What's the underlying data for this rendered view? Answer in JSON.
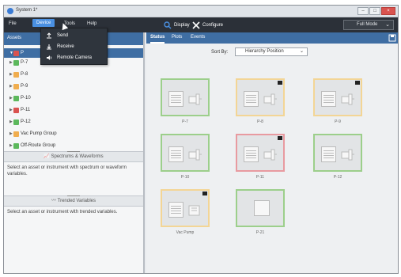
{
  "window": {
    "title": "System 1*"
  },
  "titlebar": {
    "buttons": [
      "minimize-icon",
      "maximize-icon",
      "close-icon"
    ]
  },
  "menubar": {
    "items": [
      "File",
      "Device",
      "Tools",
      "Help"
    ],
    "display_label": "Display",
    "configure_label": "Configure",
    "mode_label": "Full Mode"
  },
  "device_menu": {
    "items": [
      {
        "label": "Send",
        "icon": "upload-icon"
      },
      {
        "label": "Receive",
        "icon": "download-icon"
      },
      {
        "label": "Remote Camera",
        "icon": "speaker-icon"
      }
    ]
  },
  "left_panel": {
    "tab_label": "Assets",
    "tree": [
      {
        "label": "P",
        "color": "#d9534f",
        "selected": true
      },
      {
        "label": "P-7",
        "color": "#5cb85c"
      },
      {
        "label": "P-8",
        "color": "#f0ad4e"
      },
      {
        "label": "P-9",
        "color": "#f0ad4e"
      },
      {
        "label": "P-10",
        "color": "#5cb85c"
      },
      {
        "label": "P-11",
        "color": "#d9534f"
      },
      {
        "label": "P-12",
        "color": "#5cb85c"
      },
      {
        "label": "Vac Pump Group",
        "color": "#f0ad4e"
      },
      {
        "label": "Off-Route Group",
        "color": "#5cb85c"
      }
    ],
    "spectrum_title": "Spectrums & Waveforms",
    "spectrum_text": "Select an asset or instrument with spectrum or waveform variables.",
    "trended_title": "Trended Variables",
    "trended_text": "Select an asset or instrument with trended variables."
  },
  "right_panel": {
    "tabs": [
      "Status",
      "Plots",
      "Events"
    ],
    "sort_label": "Sort By:",
    "sort_value": "Hierarchy Position",
    "cards": [
      {
        "label": "P-7",
        "status": "green"
      },
      {
        "label": "P-8",
        "status": "yellow"
      },
      {
        "label": "P-9",
        "status": "yellow"
      },
      {
        "label": "P-10",
        "status": "green"
      },
      {
        "label": "P-11",
        "status": "red"
      },
      {
        "label": "P-12",
        "status": "green"
      },
      {
        "label": "Vac Pump",
        "status": "yellow"
      },
      {
        "label": "P-21",
        "status": "green"
      }
    ]
  }
}
